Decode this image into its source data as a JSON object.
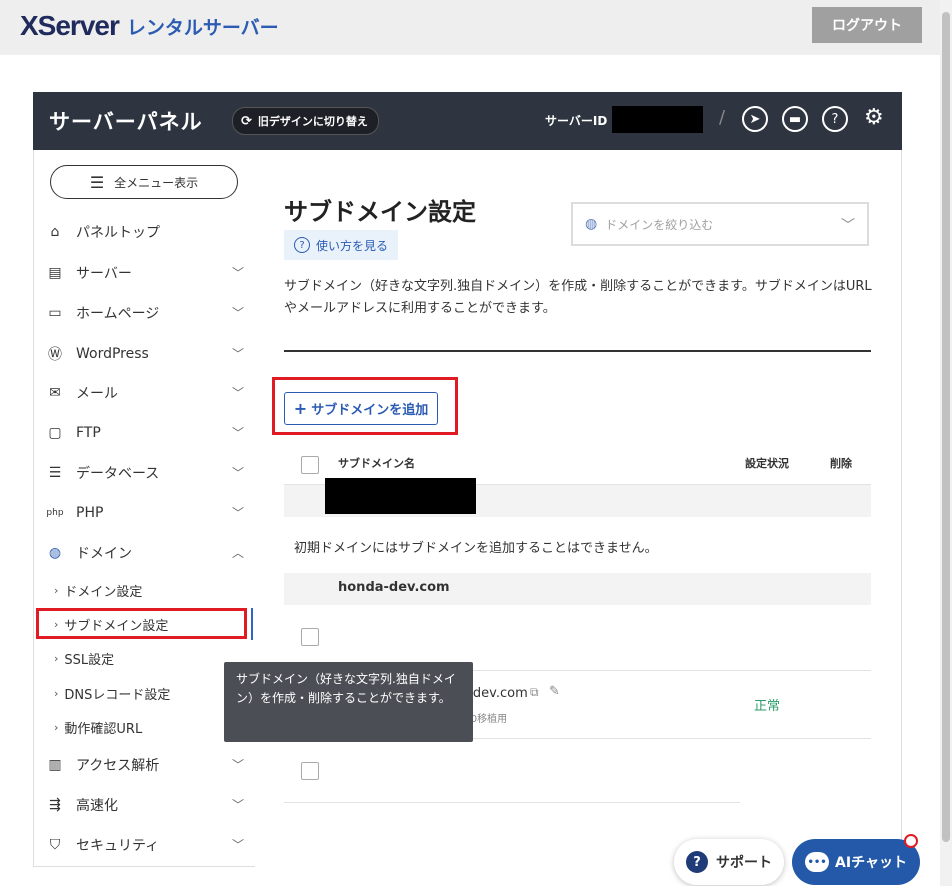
{
  "header": {
    "logo_main": "XServer",
    "logo_sub": "レンタルサーバー",
    "logout_label": "ログアウト"
  },
  "panel": {
    "title": "サーバーパネル",
    "legacy_toggle_label": "旧デザインに切り替え",
    "server_id_label": "サーバーID",
    "separator": "/"
  },
  "sidebar": {
    "menu_all_label": "全メニュー表示",
    "items": [
      {
        "label": "パネルトップ",
        "icon": "home-icon"
      },
      {
        "label": "サーバー",
        "icon": "server-icon"
      },
      {
        "label": "ホームページ",
        "icon": "window-icon"
      },
      {
        "label": "WordPress",
        "icon": "wordpress-icon"
      },
      {
        "label": "メール",
        "icon": "mail-icon"
      },
      {
        "label": "FTP",
        "icon": "monitor-icon"
      },
      {
        "label": "データベース",
        "icon": "database-icon"
      },
      {
        "label": "PHP",
        "icon": "php-icon"
      },
      {
        "label": "ドメイン",
        "icon": "globe-icon"
      },
      {
        "label": "アクセス解析",
        "icon": "bar-chart-icon"
      },
      {
        "label": "高速化",
        "icon": "speed-icon"
      },
      {
        "label": "セキュリティ",
        "icon": "shield-icon"
      }
    ],
    "domain_sub_items": [
      {
        "label": "ドメイン設定"
      },
      {
        "label": "サブドメイン設定"
      },
      {
        "label": "SSL設定"
      },
      {
        "label": "DNSレコード設定"
      },
      {
        "label": "動作確認URL"
      }
    ]
  },
  "main": {
    "title": "サブドメイン設定",
    "howto_label": "使い方を見る",
    "domain_filter_placeholder": "ドメインを絞り込む",
    "description": "サブドメイン（好きな文字列.独自ドメイン）を作成・削除することができます。サブドメインはURLやメールアドレスに利用することができます。",
    "add_button_label": "サブドメインを追加",
    "table": {
      "col_name": "サブドメイン名",
      "col_status": "設定状況",
      "col_delete": "削除"
    },
    "initial_domain_note": "初期ドメインにはサブドメインを追加することはできません。",
    "domain_group": "honda-dev.com",
    "subdomain_row": {
      "name_visible": "da-dev.com",
      "memo": "映画レビューアプリLaravel10移植用",
      "status": "正常"
    }
  },
  "tooltip": {
    "text": "サブドメイン（好きな文字列.独自ドメイン）を作成・削除することができます。"
  },
  "footer": {
    "support_label": "サポート",
    "ai_chat_label": "AIチャット"
  }
}
